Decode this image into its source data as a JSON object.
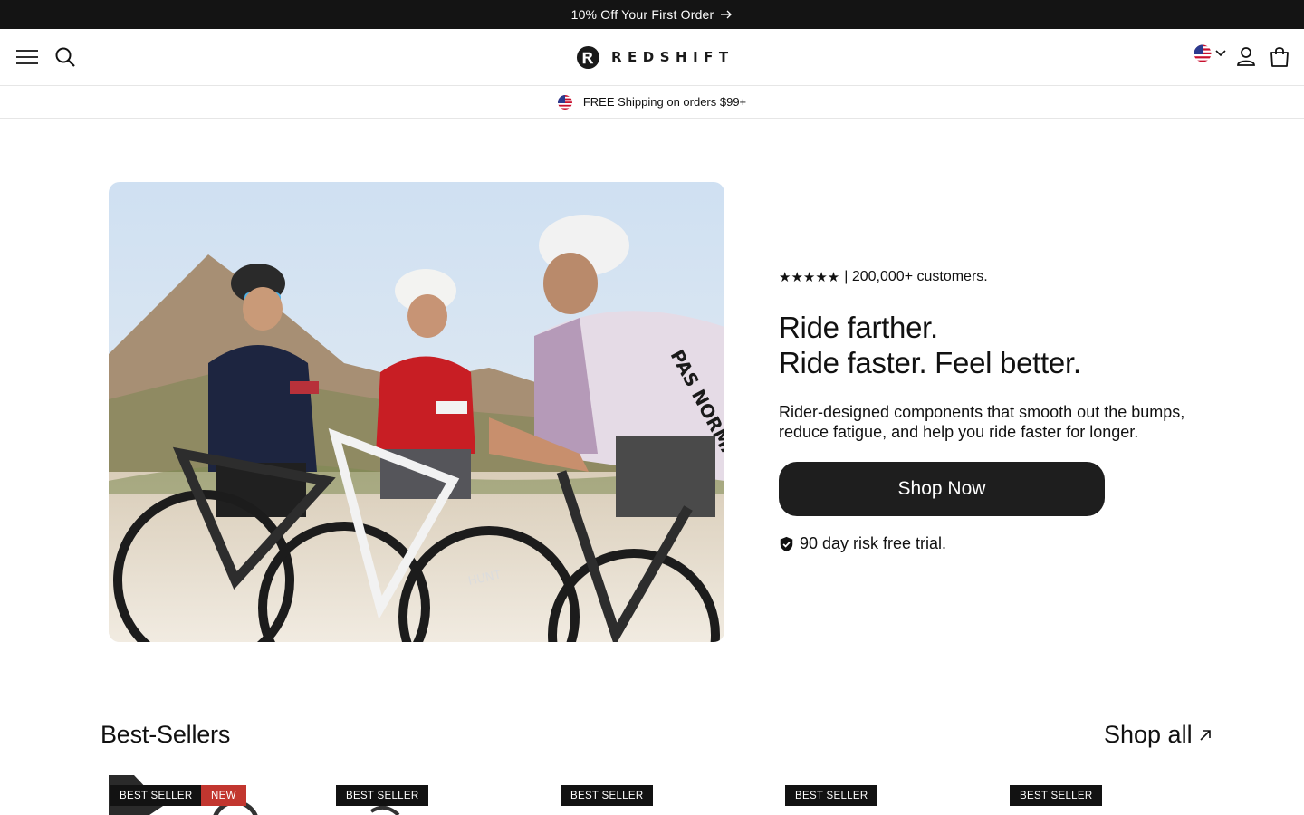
{
  "announcement": {
    "text": "10% Off Your First Order",
    "arrow_icon": "arrow-right-icon"
  },
  "header": {
    "logo_text": "REDSHIFT",
    "icons": [
      "hamburger-menu-icon",
      "search-icon",
      "us-flag-icon",
      "chevron-down-icon",
      "user-icon",
      "shopping-bag-icon"
    ]
  },
  "shipping_bar": {
    "text": "FREE Shipping on orders $99+",
    "flag_icon": "us-flag-icon"
  },
  "hero": {
    "rating_stars": "★★★★★",
    "rating_text": "| 200,000+ customers.",
    "headline_line1": "Ride farther.",
    "headline_line2": "Ride faster. Feel better.",
    "subtext": "Rider-designed components that smooth out the bumps, reduce fatigue, and help you ride faster for longer.",
    "cta_label": "Shop Now",
    "trial_text": "90 day risk free trial.",
    "jersey_text": "PAS NORMAL",
    "wheel_text": "HUNT"
  },
  "best_sellers": {
    "title": "Best-Sellers",
    "shop_all_label": "Shop all",
    "cards": [
      {
        "badges": [
          "BEST SELLER",
          "NEW"
        ]
      },
      {
        "badges": [
          "BEST SELLER"
        ]
      },
      {
        "badges": [
          "BEST SELLER"
        ]
      },
      {
        "badges": [
          "BEST SELLER"
        ]
      },
      {
        "badges": [
          "BEST SELLER"
        ]
      }
    ]
  },
  "colors": {
    "accent_dark": "#141414",
    "badge_new": "#c2362f",
    "cta": "#1e1e1e"
  }
}
